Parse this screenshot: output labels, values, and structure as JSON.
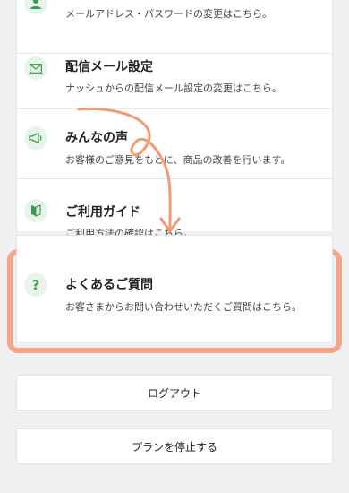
{
  "menu": {
    "items": [
      {
        "title": "",
        "desc": "メールアドレス・パスワードの変更はこちら。",
        "icon": "user-icon"
      },
      {
        "title": "配信メール設定",
        "desc": "ナッシュからの配信メール設定の変更はこちら。",
        "icon": "mail-icon"
      },
      {
        "title": "みんなの声",
        "desc": "お客様のご意見をもとに、商品の改善を行います。",
        "icon": "megaphone-icon"
      },
      {
        "title": "ご利用ガイド",
        "desc": "ご利用方法の確認はこちら。",
        "icon": "book-icon"
      }
    ],
    "faq": {
      "icon_text": "?",
      "title": "よくあるご質問",
      "desc": "お客さまからお問い合わせいただくご質問はこちら。",
      "icon": "question-icon"
    }
  },
  "buttons": {
    "logout": "ログアウト",
    "stop_plan": "プランを停止する"
  },
  "colors": {
    "highlight": "#f6a585",
    "icon_bg": "#e7f4ea",
    "icon_fg": "#3c9a4e",
    "arrow": "#f39a75"
  }
}
